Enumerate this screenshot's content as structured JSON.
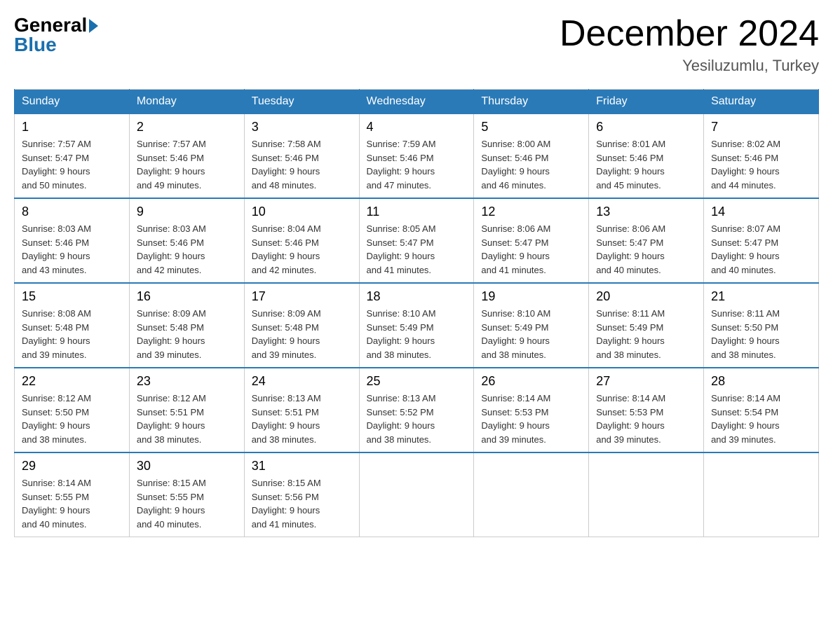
{
  "logo": {
    "general": "General",
    "blue": "Blue"
  },
  "title": "December 2024",
  "subtitle": "Yesiluzumlu, Turkey",
  "weekdays": [
    "Sunday",
    "Monday",
    "Tuesday",
    "Wednesday",
    "Thursday",
    "Friday",
    "Saturday"
  ],
  "weeks": [
    [
      {
        "day": "1",
        "sunrise": "7:57 AM",
        "sunset": "5:47 PM",
        "daylight": "9 hours and 50 minutes."
      },
      {
        "day": "2",
        "sunrise": "7:57 AM",
        "sunset": "5:46 PM",
        "daylight": "9 hours and 49 minutes."
      },
      {
        "day": "3",
        "sunrise": "7:58 AM",
        "sunset": "5:46 PM",
        "daylight": "9 hours and 48 minutes."
      },
      {
        "day": "4",
        "sunrise": "7:59 AM",
        "sunset": "5:46 PM",
        "daylight": "9 hours and 47 minutes."
      },
      {
        "day": "5",
        "sunrise": "8:00 AM",
        "sunset": "5:46 PM",
        "daylight": "9 hours and 46 minutes."
      },
      {
        "day": "6",
        "sunrise": "8:01 AM",
        "sunset": "5:46 PM",
        "daylight": "9 hours and 45 minutes."
      },
      {
        "day": "7",
        "sunrise": "8:02 AM",
        "sunset": "5:46 PM",
        "daylight": "9 hours and 44 minutes."
      }
    ],
    [
      {
        "day": "8",
        "sunrise": "8:03 AM",
        "sunset": "5:46 PM",
        "daylight": "9 hours and 43 minutes."
      },
      {
        "day": "9",
        "sunrise": "8:03 AM",
        "sunset": "5:46 PM",
        "daylight": "9 hours and 42 minutes."
      },
      {
        "day": "10",
        "sunrise": "8:04 AM",
        "sunset": "5:46 PM",
        "daylight": "9 hours and 42 minutes."
      },
      {
        "day": "11",
        "sunrise": "8:05 AM",
        "sunset": "5:47 PM",
        "daylight": "9 hours and 41 minutes."
      },
      {
        "day": "12",
        "sunrise": "8:06 AM",
        "sunset": "5:47 PM",
        "daylight": "9 hours and 41 minutes."
      },
      {
        "day": "13",
        "sunrise": "8:06 AM",
        "sunset": "5:47 PM",
        "daylight": "9 hours and 40 minutes."
      },
      {
        "day": "14",
        "sunrise": "8:07 AM",
        "sunset": "5:47 PM",
        "daylight": "9 hours and 40 minutes."
      }
    ],
    [
      {
        "day": "15",
        "sunrise": "8:08 AM",
        "sunset": "5:48 PM",
        "daylight": "9 hours and 39 minutes."
      },
      {
        "day": "16",
        "sunrise": "8:09 AM",
        "sunset": "5:48 PM",
        "daylight": "9 hours and 39 minutes."
      },
      {
        "day": "17",
        "sunrise": "8:09 AM",
        "sunset": "5:48 PM",
        "daylight": "9 hours and 39 minutes."
      },
      {
        "day": "18",
        "sunrise": "8:10 AM",
        "sunset": "5:49 PM",
        "daylight": "9 hours and 38 minutes."
      },
      {
        "day": "19",
        "sunrise": "8:10 AM",
        "sunset": "5:49 PM",
        "daylight": "9 hours and 38 minutes."
      },
      {
        "day": "20",
        "sunrise": "8:11 AM",
        "sunset": "5:49 PM",
        "daylight": "9 hours and 38 minutes."
      },
      {
        "day": "21",
        "sunrise": "8:11 AM",
        "sunset": "5:50 PM",
        "daylight": "9 hours and 38 minutes."
      }
    ],
    [
      {
        "day": "22",
        "sunrise": "8:12 AM",
        "sunset": "5:50 PM",
        "daylight": "9 hours and 38 minutes."
      },
      {
        "day": "23",
        "sunrise": "8:12 AM",
        "sunset": "5:51 PM",
        "daylight": "9 hours and 38 minutes."
      },
      {
        "day": "24",
        "sunrise": "8:13 AM",
        "sunset": "5:51 PM",
        "daylight": "9 hours and 38 minutes."
      },
      {
        "day": "25",
        "sunrise": "8:13 AM",
        "sunset": "5:52 PM",
        "daylight": "9 hours and 38 minutes."
      },
      {
        "day": "26",
        "sunrise": "8:14 AM",
        "sunset": "5:53 PM",
        "daylight": "9 hours and 39 minutes."
      },
      {
        "day": "27",
        "sunrise": "8:14 AM",
        "sunset": "5:53 PM",
        "daylight": "9 hours and 39 minutes."
      },
      {
        "day": "28",
        "sunrise": "8:14 AM",
        "sunset": "5:54 PM",
        "daylight": "9 hours and 39 minutes."
      }
    ],
    [
      {
        "day": "29",
        "sunrise": "8:14 AM",
        "sunset": "5:55 PM",
        "daylight": "9 hours and 40 minutes."
      },
      {
        "day": "30",
        "sunrise": "8:15 AM",
        "sunset": "5:55 PM",
        "daylight": "9 hours and 40 minutes."
      },
      {
        "day": "31",
        "sunrise": "8:15 AM",
        "sunset": "5:56 PM",
        "daylight": "9 hours and 41 minutes."
      },
      null,
      null,
      null,
      null
    ]
  ],
  "labels": {
    "sunrise": "Sunrise:",
    "sunset": "Sunset:",
    "daylight": "Daylight:"
  }
}
